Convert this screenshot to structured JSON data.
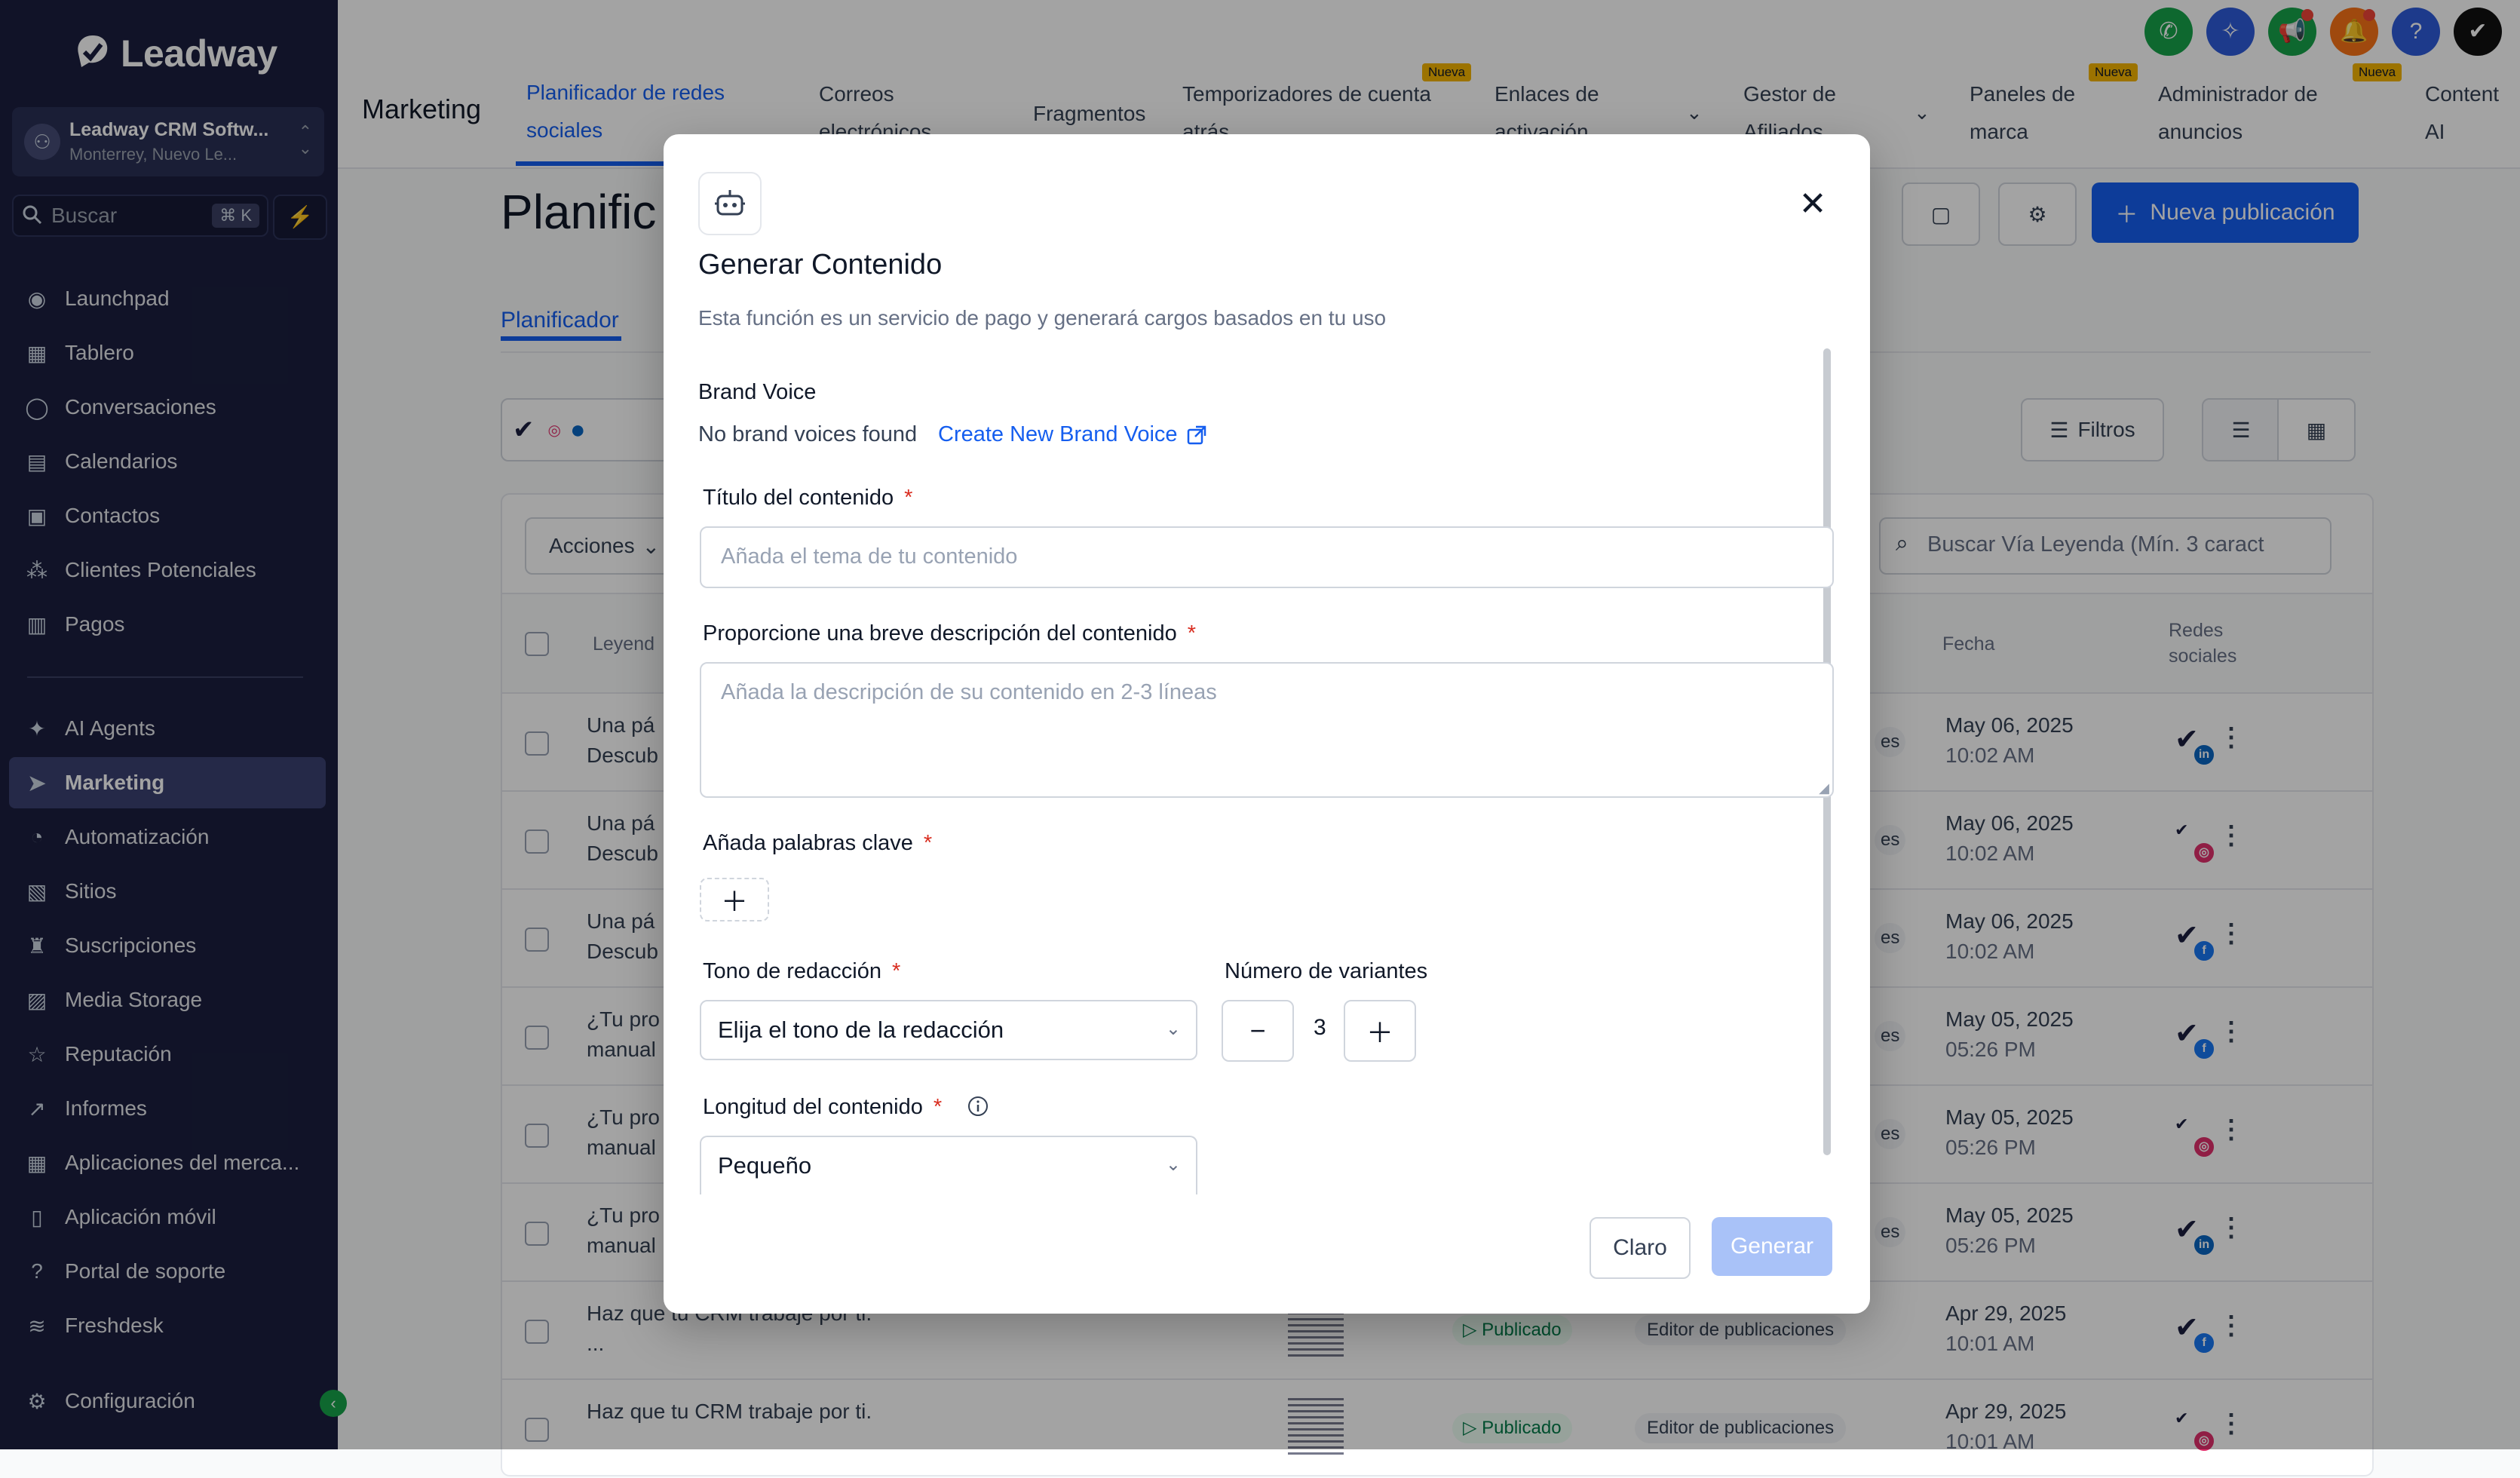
{
  "brand": {
    "name": "Leadway",
    "accent": "#155eef"
  },
  "account": {
    "name": "Leadway CRM Softw...",
    "location": "Monterrey, Nuevo Le..."
  },
  "search": {
    "placeholder": "Buscar",
    "shortcut": "⌘ K"
  },
  "sidebar": {
    "items": [
      {
        "label": "Launchpad",
        "icon": "rocket-icon"
      },
      {
        "label": "Tablero",
        "icon": "dashboard-icon"
      },
      {
        "label": "Conversaciones",
        "icon": "chat-icon"
      },
      {
        "label": "Calendarios",
        "icon": "calendar-icon"
      },
      {
        "label": "Contactos",
        "icon": "contacts-icon"
      },
      {
        "label": "Clientes Potenciales",
        "icon": "leads-icon"
      },
      {
        "label": "Pagos",
        "icon": "payments-icon"
      },
      {
        "label": "AI Agents",
        "icon": "sparkle-icon"
      },
      {
        "label": "Marketing",
        "icon": "send-icon",
        "active": true
      },
      {
        "label": "Automatización",
        "icon": "automation-icon"
      },
      {
        "label": "Sitios",
        "icon": "sites-icon"
      },
      {
        "label": "Suscripciones",
        "icon": "subscriptions-icon"
      },
      {
        "label": "Media Storage",
        "icon": "image-icon"
      },
      {
        "label": "Reputación",
        "icon": "star-icon"
      },
      {
        "label": "Informes",
        "icon": "chart-icon"
      },
      {
        "label": "Aplicaciones del merca...",
        "icon": "apps-icon"
      },
      {
        "label": "Aplicación móvil",
        "icon": "mobile-icon"
      },
      {
        "label": "Portal de soporte",
        "icon": "help-icon"
      },
      {
        "label": "Freshdesk",
        "icon": "freshdesk-icon"
      },
      {
        "label": "Configuración",
        "icon": "gear-icon"
      }
    ]
  },
  "topbar": {
    "section": "Marketing",
    "tabs": [
      {
        "l1": "Planificador de redes",
        "l2": "sociales",
        "active": true
      },
      {
        "l1": "Correos",
        "l2": "electrónicos"
      },
      {
        "l1": "Fragmentos",
        "l2": ""
      },
      {
        "l1": "Temporizadores de cuenta",
        "l2": "atrás",
        "badge": "Nueva"
      },
      {
        "l1": "Enlaces de",
        "l2": "activación"
      },
      {
        "l1": "Gestor de",
        "l2": "Afiliados"
      },
      {
        "l1": "Paneles de",
        "l2": "marca",
        "badge": "Nueva"
      },
      {
        "l1": "Administrador de",
        "l2": "anuncios",
        "badge": "Nueva"
      },
      {
        "l1": "Content",
        "l2": "AI"
      }
    ]
  },
  "page": {
    "title": "Planific",
    "subtab": "Planificador",
    "new_post": "Nueva publicación",
    "filters": "Filtros",
    "actions": "Acciones",
    "search_placeholder": "Buscar Vía Leyenda (Mín. 3 caract",
    "columns": {
      "caption": "Leyend",
      "date": "Fecha",
      "social1": "Redes",
      "social2": "sociales"
    },
    "status_label": "Publicado",
    "chip_label": "Editor de publicaciones",
    "rows": [
      {
        "c1": "Una pá",
        "c2": "Descub",
        "date": "May 06, 2025",
        "time": "10:02 AM",
        "net": "linkedin",
        "chip": "es"
      },
      {
        "c1": "Una pá",
        "c2": "Descub",
        "date": "May 06, 2025",
        "time": "10:02 AM",
        "net": "instagram",
        "chip": "es"
      },
      {
        "c1": "Una pá",
        "c2": "Descub",
        "date": "May 06, 2025",
        "time": "10:02 AM",
        "net": "facebook",
        "chip": "es"
      },
      {
        "c1": "¿Tu pro",
        "c2": "manual",
        "date": "May 05, 2025",
        "time": "05:26 PM",
        "net": "facebook",
        "chip": "es"
      },
      {
        "c1": "¿Tu pro",
        "c2": "manual",
        "date": "May 05, 2025",
        "time": "05:26 PM",
        "net": "instagram",
        "chip": "es"
      },
      {
        "c1": "¿Tu pro",
        "c2": "manual",
        "date": "May 05, 2025",
        "time": "05:26 PM",
        "net": "linkedin",
        "chip": "es"
      },
      {
        "c1": "Haz que tu CRM trabaje por ti.",
        "c2": "...",
        "date": "Apr 29, 2025",
        "time": "10:01 AM",
        "net": "facebook",
        "chip": "full"
      },
      {
        "c1": "Haz que tu CRM trabaje por ti.",
        "c2": "",
        "date": "Apr 29, 2025",
        "time": "10:01 AM",
        "net": "instagram",
        "chip": "full"
      }
    ]
  },
  "modal": {
    "title": "Generar Contenido",
    "subtitle": "Esta función es un servicio de pago y generará cargos basados en tu uso",
    "brand_voice_label": "Brand Voice",
    "no_voices": "No brand voices found",
    "create_voice": "Create New Brand Voice",
    "title_label": "Título del contenido",
    "title_placeholder": "Añada el tema de tu contenido",
    "desc_label": "Proporcione una breve descripción del contenido",
    "desc_placeholder": "Añada la descripción de su contenido en 2-3 líneas",
    "keywords_label": "Añada palabras clave",
    "tone_label": "Tono de redacción",
    "tone_value": "Elija el tono de la redacción",
    "variants_label": "Número de variantes",
    "variants_value": "3",
    "length_label": "Longitud del contenido",
    "length_value": "Pequeño",
    "required_mark": "*",
    "clear_button": "Claro",
    "generate_button": "Generar"
  }
}
